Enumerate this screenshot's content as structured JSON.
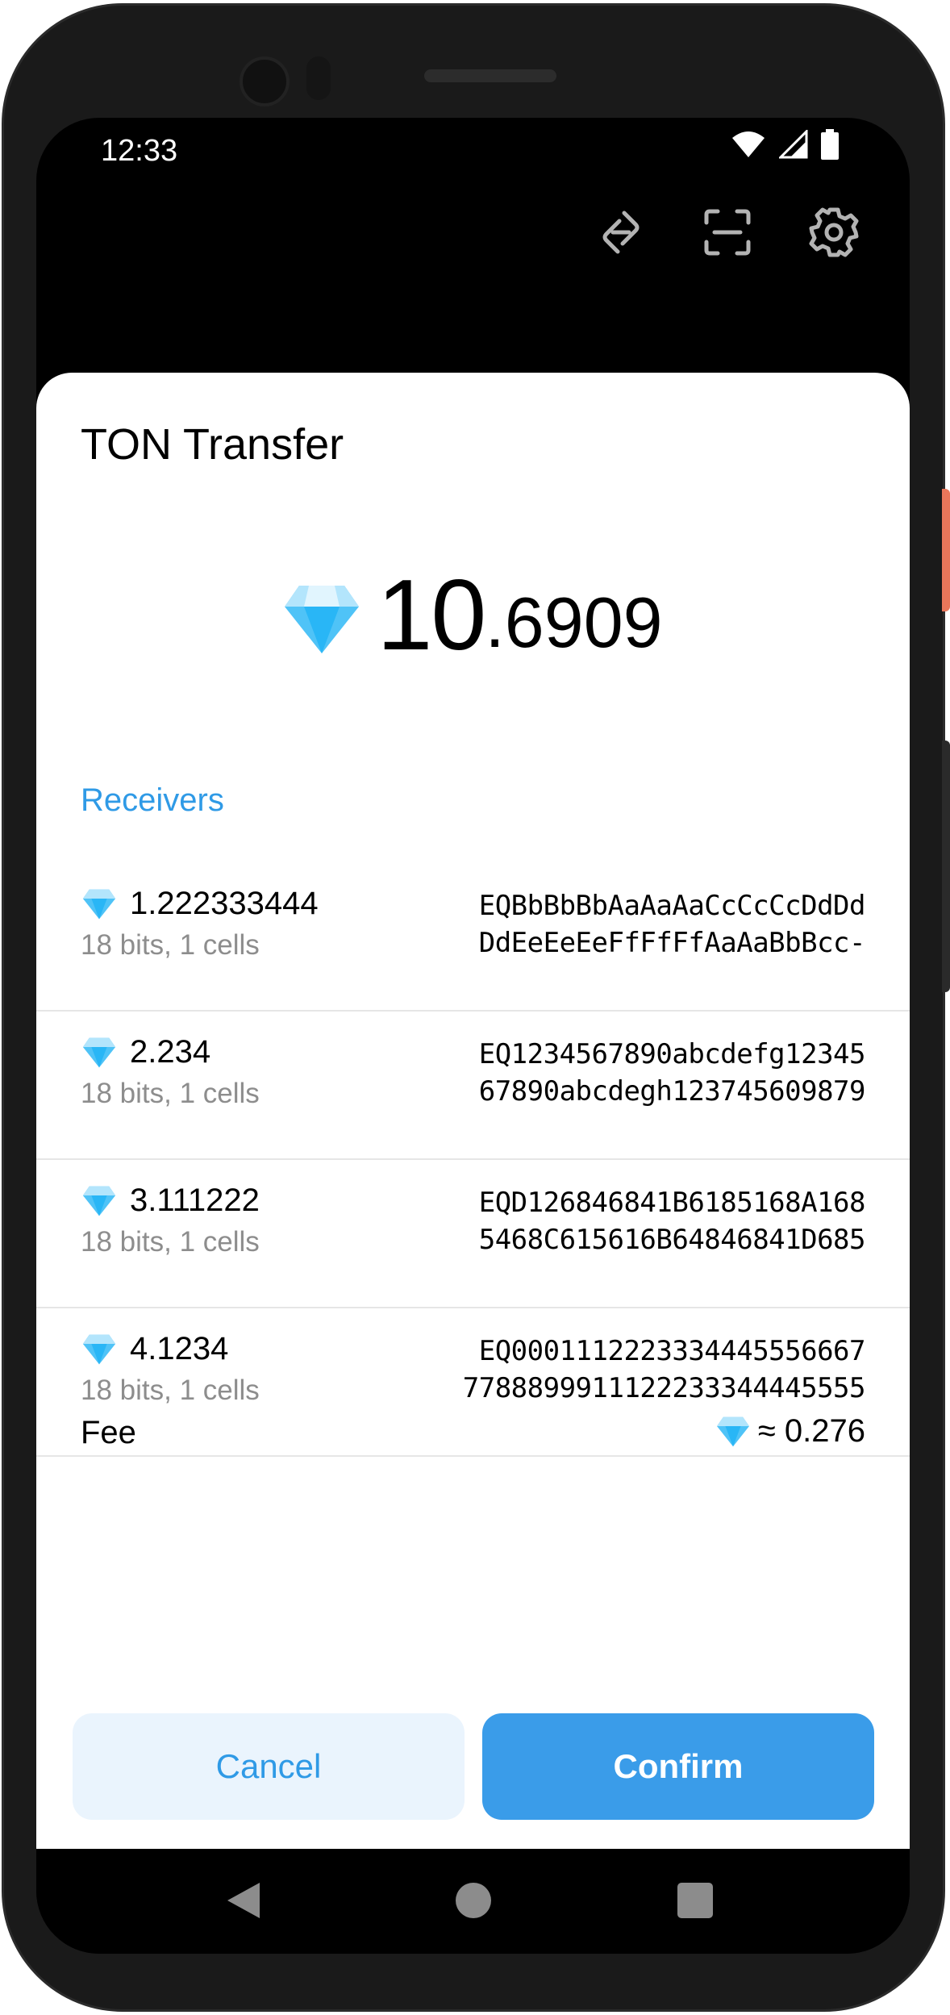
{
  "status_bar": {
    "time": "12:33"
  },
  "header_icons": [
    "link-icon",
    "scan-icon",
    "gear-icon"
  ],
  "sheet": {
    "title": "TON Transfer",
    "amount_int": "10",
    "amount_frac": ".6909",
    "receivers_label": "Receivers",
    "receivers": [
      {
        "amount": "1.222333444",
        "sub": "18 bits, 1 cells",
        "address_line1": "EQBbBbBbAaAaAaCcCcCcDdDd",
        "address_line2": "DdEeEeEeFfFfFfAaAaBbBcc-"
      },
      {
        "amount": "2.234",
        "sub": "18 bits, 1 cells",
        "address_line1": "EQ1234567890abcdefg12345",
        "address_line2": "67890abcdegh123745609879"
      },
      {
        "amount": "3.111222",
        "sub": "18 bits, 1 cells",
        "address_line1": "EQD126846841B6185168A168",
        "address_line2": "5468C615616B64846841D685"
      },
      {
        "amount": "4.1234",
        "sub": "18 bits, 1 cells",
        "address_line1": "EQ0001112223334445556667",
        "address_line2": "7788899911122233344445555"
      }
    ],
    "fee_label": "Fee",
    "fee_value": "≈ 0.276",
    "cancel_label": "Cancel",
    "confirm_label": "Confirm"
  },
  "colors": {
    "accent": "#3a9ce9",
    "accent_text": "#2f9ae6",
    "cancel_bg": "#eaf4fd",
    "muted": "#8d8d8d",
    "gem": "#4fc3f7"
  }
}
